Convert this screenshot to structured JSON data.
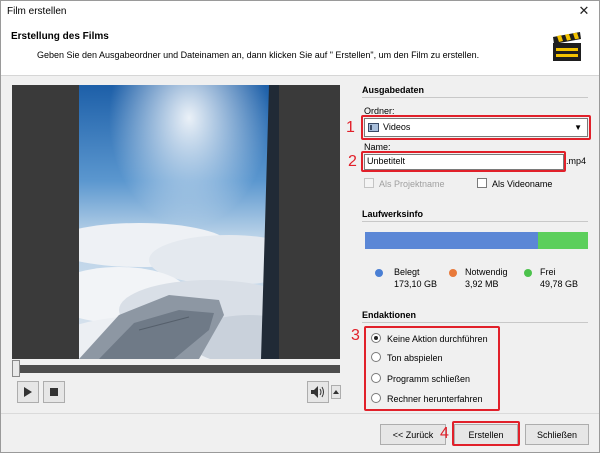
{
  "window": {
    "title": "Film erstellen",
    "close_glyph": "✕"
  },
  "header": {
    "title": "Erstellung des Films",
    "description": "Geben Sie den Ausgabeordner und Dateinamen an, dann klicken Sie auf \" Erstellen\", um den Film zu erstellen.",
    "icon": "clapperboard-icon"
  },
  "output": {
    "section_title": "Ausgabedaten",
    "folder_label": "Ordner:",
    "folder_value": "Videos",
    "name_label": "Name:",
    "name_value": "Unbetitelt",
    "extension": ".mp4",
    "as_project_name": "Als Projektname",
    "as_video_name": "Als Videoname"
  },
  "drive": {
    "section_title": "Laufwerksinfo",
    "used_fraction": 0.775,
    "legend": [
      {
        "label": "Belegt",
        "value": "173,10 GB",
        "color": "#4a7fd4"
      },
      {
        "label": "Notwendig",
        "value": "3,92 MB",
        "color": "#e8793a"
      },
      {
        "label": "Frei",
        "value": "49,78 GB",
        "color": "#4cc24c"
      }
    ]
  },
  "end_actions": {
    "section_title": "Endaktionen",
    "options": [
      "Keine Aktion durchführen",
      "Ton abspielen",
      "Programm schließen",
      "Rechner herunterfahren"
    ],
    "selected_index": 0
  },
  "annotations": [
    "1",
    "2",
    "3",
    "4"
  ],
  "footer": {
    "back": "<< Zurück",
    "create": "Erstellen",
    "close": "Schließen"
  },
  "colors": {
    "annotation_red": "#e1202a",
    "disk_used": "#5b87d6",
    "disk_free": "#5ccf5c"
  }
}
